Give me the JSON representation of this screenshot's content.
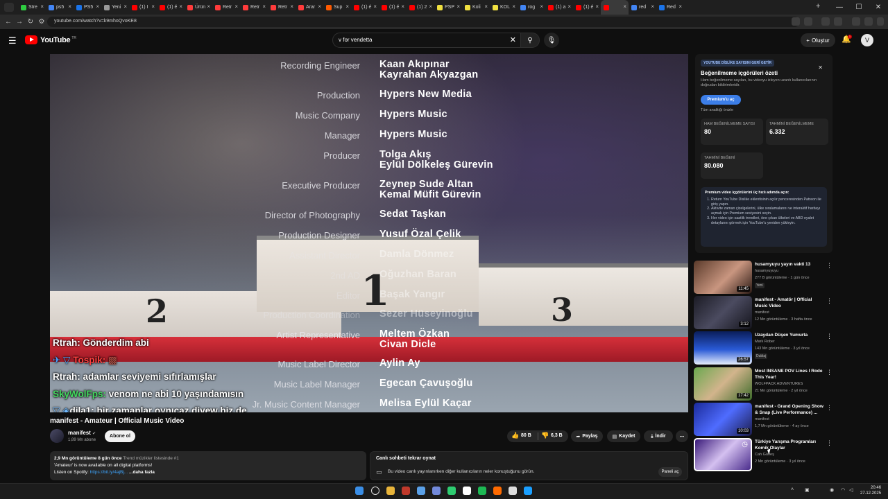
{
  "browser": {
    "tabs": [
      {
        "label": "Stre",
        "color": "#2ecc40"
      },
      {
        "label": "ps5",
        "color": "#4285f4"
      },
      {
        "label": "PS5",
        "color": "#1a73e8"
      },
      {
        "label": "Yeni",
        "color": "#999999"
      },
      {
        "label": "(1) I",
        "color": "#ff0000"
      },
      {
        "label": "(1) é",
        "color": "#ff0000"
      },
      {
        "label": "Ürün",
        "color": "#ff3b3b"
      },
      {
        "label": "Retr",
        "color": "#ff3b3b"
      },
      {
        "label": "Retr",
        "color": "#ff3b3b"
      },
      {
        "label": "Retr",
        "color": "#ff3b3b"
      },
      {
        "label": "Arar",
        "color": "#ff3b3b"
      },
      {
        "label": "Sup",
        "color": "#ff5a00"
      },
      {
        "label": "(1) é",
        "color": "#ff0000"
      },
      {
        "label": "(1) é",
        "color": "#ff0000"
      },
      {
        "label": "(1) 2",
        "color": "#ff0000"
      },
      {
        "label": "PSP",
        "color": "#f0e040"
      },
      {
        "label": "Koli",
        "color": "#f0e040"
      },
      {
        "label": "KOL",
        "color": "#f0e040"
      },
      {
        "label": "rog",
        "color": "#4285f4"
      },
      {
        "label": "(1) a",
        "color": "#ff0000"
      },
      {
        "label": "(1) é",
        "color": "#ff0000"
      },
      {
        "label": "",
        "color": "#ff0000"
      },
      {
        "label": "red",
        "color": "#4285f4"
      },
      {
        "label": "Red",
        "color": "#1a73e8"
      }
    ],
    "url": "youtube.com/watch?v=k9mhoQvoKE8"
  },
  "header": {
    "logo_text": "YouTube",
    "logo_region": "TR",
    "search_value": "v for vendetta",
    "create_label": "Oluştur",
    "bell_badge": "1",
    "avatar_letter": "V"
  },
  "video": {
    "credits": [
      {
        "role": "Recording Engineer",
        "names": [
          "Kaan Akıpınar",
          "Kayrahan Akyazgan"
        ]
      },
      {
        "role": "Production",
        "names": [
          "Hypers New Media"
        ]
      },
      {
        "role": "Music Company",
        "names": [
          "Hypers Music"
        ]
      },
      {
        "role": "Manager",
        "names": [
          "Hypers Music"
        ]
      },
      {
        "role": "Producer",
        "names": [
          "Tolga Akış",
          "Eylül Dölkeleş Gürevin"
        ]
      },
      {
        "role": "Executive Producer",
        "names": [
          "Zeynep Sude Altan",
          "Kemal Müfit Gürevin"
        ]
      },
      {
        "role": "Director of Photography",
        "names": [
          "Sedat Taşkan"
        ]
      },
      {
        "role": "Production Designer",
        "names": [
          "Yusuf Özal Çelik"
        ]
      },
      {
        "role": "Assistant Director",
        "names": [
          "Damla Dönmez"
        ]
      },
      {
        "role": "2nd AD",
        "names": [
          "Oğuzhan Baran"
        ]
      },
      {
        "role": "Editor",
        "names": [
          "Başak Yangır"
        ]
      },
      {
        "role": "Production Coordination",
        "names": [
          "Sezer Hüseyinoğlu"
        ]
      },
      {
        "role": "Artist Representative",
        "names": [
          "Meltem Özkan",
          "Civan Dicle"
        ]
      },
      {
        "role": "Music Label Director",
        "names": [
          "Aylin Ay"
        ]
      },
      {
        "role": "Music Label Manager",
        "names": [
          "Egecan Çavuşoğlu"
        ]
      },
      {
        "role": "Jr. Music Content Manager",
        "names": [
          "Melisa Eylül Kaçar"
        ]
      }
    ],
    "podium_numbers": [
      "2",
      "1",
      "3"
    ],
    "chat": [
      {
        "user": "Rtrah:",
        "msg": "Gönderdim abi",
        "style": "u"
      },
      {
        "user": "Tospik:",
        "msg": "",
        "style": "tp"
      },
      {
        "user": "Rtrah:",
        "msg": "adamlar seviyemi sıfırlamışlar",
        "style": "u"
      },
      {
        "user": "SkyWolFps:",
        "msg": "venom ne abi 10 yaşındamısın",
        "style": "sk"
      },
      {
        "user": "dila1:",
        "msg": "bir zamanlar oynıcaz diyew biz de indirmistik hatirliyor musun ömer @Synapsy",
        "style": "u"
      }
    ]
  },
  "below": {
    "title": "manifest - Amateur | Official Music Video",
    "channel": "manifest",
    "subs": "1,89 Mn abone",
    "subscribe": "Abone ol",
    "likes": "80 B",
    "dislikes": "6,3 B",
    "share": "Paylaş",
    "save": "Kaydet",
    "download": "İndir",
    "desc_views": "2,9 Mn görüntüleme  8 gün önce",
    "desc_trend": "Trend müzikler listesinde #1",
    "desc_line1": "'Amateur' is now available on all digital platforms!",
    "desc_line2_prefix": "Listen on Spotify: ",
    "desc_link": "https://bit.ly/4ajBj...",
    "desc_more": "...daha fazla",
    "replay_title": "Canlı sohbeti tekrar oynat",
    "replay_desc": "Bu video canlı yayınlanırken diğer kullanıcıların neler konuştuğunu görün.",
    "replay_btn": "Paneli aç"
  },
  "panel": {
    "badge": "YOUTUBE DİSLİKE SAYISINI GERİ GETİR",
    "title": "Beğenilmeme içgörüleri özeti",
    "desc": "Ham beğenilmeme sayıları, bu videoyu izleyen uzantı kullanıcılarının doğrudan bildirimleridir.",
    "btn": "Premium'u aç",
    "link": "Tüm analitiği önizle",
    "stats": [
      {
        "label": "HAM BEĞENİLMEME SAYISI",
        "value": "80"
      },
      {
        "label": "TAHMİNİ BEĞENİLMEME",
        "value": "6.332"
      },
      {
        "label": "TAHMİNİ BEĞENİ",
        "value": "80.080"
      }
    ],
    "info_title": "Premium video içgörülerini üç hızlı adımda açın:",
    "info_steps": [
      "Return YouTube Dislike eklentisinin açılır penceresinden Patreon ile giriş yapın.",
      "Aktivite zaman çizelgelerini, ülke sıralamalarını ve interaktif haritayı açmak için Premium seviyesini seçin.",
      "Her video için saatlik trendleri, öne çıkan ülkeleri ve ABD eyalet detaylarını görmek için YouTube'u yeniden yükleyin."
    ]
  },
  "recommendations": [
    {
      "title": "husamyuyu yayın vakti 13",
      "channel": "husamyuyuyu",
      "meta": "277 B görüntüleme · 1 gün önce",
      "tag": "Yeni",
      "duration": "11:45"
    },
    {
      "title": "manifest - Amatör | Official Music Video",
      "channel": "manifest",
      "meta": "12 Mn görüntüleme · 3 hafta önce",
      "tag": "",
      "duration": "3:12"
    },
    {
      "title": "Uzaydan Düşen Yumurta",
      "channel": "Mark Rober",
      "meta": "143 Mn görüntüleme · 3 yıl önce",
      "tag": "Dublaj",
      "duration": "26:57"
    },
    {
      "title": "Most INSANE POV Lines I Rode This Year!",
      "channel": "WOLFPACK ADVENTURES",
      "meta": "21 Mn görüntüleme · 2 yıl önce",
      "tag": "",
      "duration": "17:42"
    },
    {
      "title": "manifest - Grand Opening Show & Snap (Live Performance) ...",
      "channel": "manifest",
      "meta": "1,7 Mn görüntüleme · 4 ay önce",
      "tag": "",
      "duration": "10:03"
    },
    {
      "title": "Türkiye Yarışma Programları Komik Olaylar",
      "channel": "Cah Güneş",
      "meta": "2 Mn görüntüleme · 3 yıl önce",
      "tag": "",
      "duration": ""
    }
  ],
  "taskbar": {
    "time": "20:46",
    "date": "27.12.2025"
  }
}
